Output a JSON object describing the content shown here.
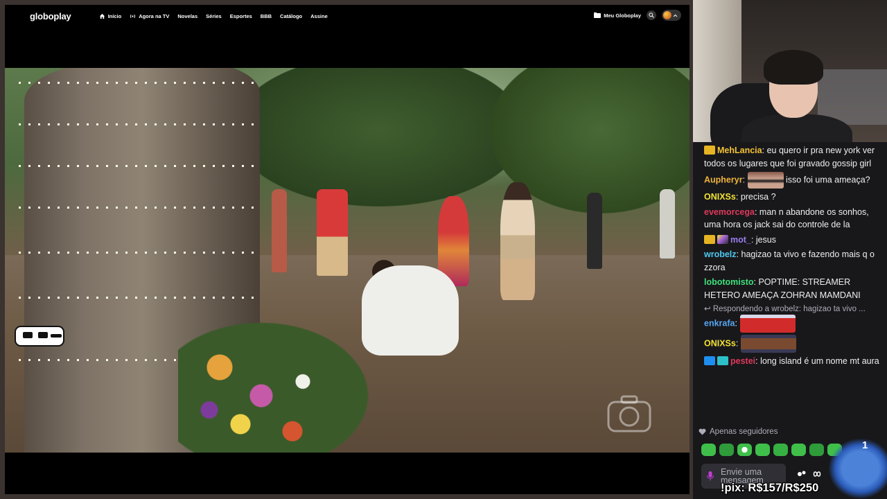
{
  "browser": {
    "brand": "globoplay",
    "nav": [
      {
        "label": "Início",
        "icon": "home-icon"
      },
      {
        "label": "Agora na TV",
        "icon": "live-broadcast-icon"
      },
      {
        "label": "Novelas"
      },
      {
        "label": "Séries"
      },
      {
        "label": "Esportes"
      },
      {
        "label": "BBB"
      },
      {
        "label": "Catálogo"
      },
      {
        "label": "Assine"
      }
    ],
    "meu_globoplay": "Meu Globoplay",
    "icons": {
      "search": "search-icon",
      "profile": "profile-avatar-icon",
      "chevron": "chevron-up-icon"
    }
  },
  "chat": {
    "messages": [
      {
        "user": "MehLancia",
        "user_color": "#f4c233",
        "badges": [
          "crown-badge"
        ],
        "text": "eu quero ir pra new york ver todos os lugares que foi gravado gossip girl"
      },
      {
        "user": "Aupheryr",
        "user_color": "#f0b43c",
        "emote": "sunglasses-face-emote",
        "text": "isso foi uma ameaça?"
      },
      {
        "user": "ONIXSs",
        "user_color": "#f2e233",
        "text": "precisa ?"
      },
      {
        "user": "evemorcega",
        "user_color": "#e0385a",
        "text": "man n abandone os sonhos, uma hora os jack sai do controle de la"
      },
      {
        "user": "mot_",
        "user_color": "#9b7df0",
        "badges": [
          "crown-badge",
          "nonbinary-badge"
        ],
        "text": "jesus"
      },
      {
        "user": "wrobelz",
        "user_color": "#4ec8f0",
        "text": "hagizao ta vivo e fazendo mais q o zzora"
      },
      {
        "user": "lobotomisto",
        "user_color": "#3fe07a",
        "text": "POPTIME: STREAMER HETERO AMEAÇA ZOHRAN MAMDANI"
      },
      {
        "reply": "Respondendo a wrobelz: hagizao ta vivo ..."
      },
      {
        "user": "enkrafa",
        "user_color": "#58a6f0",
        "emote": "red-shirt-man-emote",
        "text": ""
      },
      {
        "user": "ONIXSs",
        "user_color": "#f2e233",
        "emote": "smiling-man-emote",
        "text": ""
      },
      {
        "user": "pestei",
        "user_color": "#e0385a",
        "badges": [
          "prime-badge",
          "bits-badge"
        ],
        "text": "long island é um nome mt aura"
      }
    ],
    "followers_only": "Apenas seguidores",
    "emote_count": "1",
    "input_placeholder": "Envie uma mensagem",
    "pix": "!pix: R$157/R$250",
    "colors": {
      "background": "#18181b",
      "emote_green": "#3fbf4a",
      "input": "#2f2f35"
    }
  }
}
